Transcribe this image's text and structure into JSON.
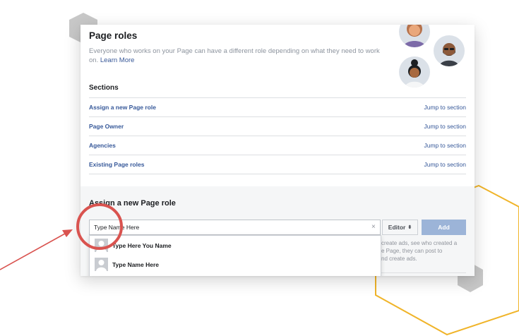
{
  "page": {
    "title": "Page roles",
    "description": "Everyone who works on your Page can have a different role depending on what they need to work on.",
    "learn_more": "Learn More"
  },
  "sections": {
    "title": "Sections",
    "items": [
      {
        "label": "Assign a new Page role",
        "jump": "Jump to section"
      },
      {
        "label": "Page Owner",
        "jump": "Jump to section"
      },
      {
        "label": "Agencies",
        "jump": "Jump to section"
      },
      {
        "label": "Existing Page roles",
        "jump": "Jump to section"
      }
    ]
  },
  "assign": {
    "title": "Assign a new Page role",
    "input_value": "Type Name Here",
    "clear_icon": "×",
    "role_value": "Editor",
    "role_chevron": "⬍",
    "add_label": "Add",
    "help_text": "create ads, see who created a\ne Page, they can post to\nnd create ads."
  },
  "suggestions": [
    {
      "name": "Type Here You Name"
    },
    {
      "name": "Type Name Here"
    }
  ],
  "colors": {
    "link": "#365899",
    "add_button": "#9cb4d8",
    "annotation_red": "#d9534f",
    "hexagon_yellow": "#f0b429",
    "hexagon_gray": "#c8c8c8"
  },
  "icons": {
    "avatars": [
      "person-avatar-icon",
      "person-avatar-icon",
      "person-avatar-icon"
    ],
    "annotation": [
      "red-arrow-icon",
      "red-circle-highlight-icon"
    ]
  }
}
